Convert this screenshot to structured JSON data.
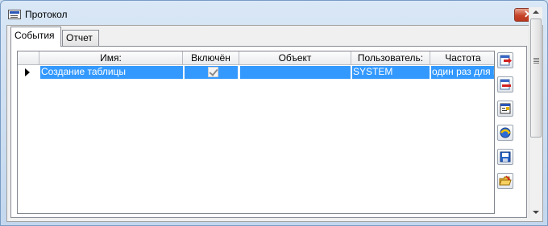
{
  "window": {
    "title": "Протокол",
    "close_label": "✕"
  },
  "tabs": [
    {
      "label": "События",
      "active": true
    },
    {
      "label": "Отчет",
      "active": false
    }
  ],
  "grid": {
    "columns": [
      "Имя:",
      "Включён",
      "Объект",
      "Пользователь:",
      "Частота"
    ],
    "rows": [
      {
        "name": "Создание таблицы",
        "enabled": true,
        "object": "",
        "user": "SYSTEM",
        "frequency": "один раз для п"
      }
    ]
  },
  "toolbar": {
    "buttons": [
      "add-icon",
      "delete-icon",
      "properties-icon",
      "refresh-icon",
      "save-icon",
      "open-folder-icon"
    ]
  },
  "colors": {
    "selection": "#3399ff",
    "window_frame": "#c3d7ee",
    "close_button": "#c5452a"
  }
}
